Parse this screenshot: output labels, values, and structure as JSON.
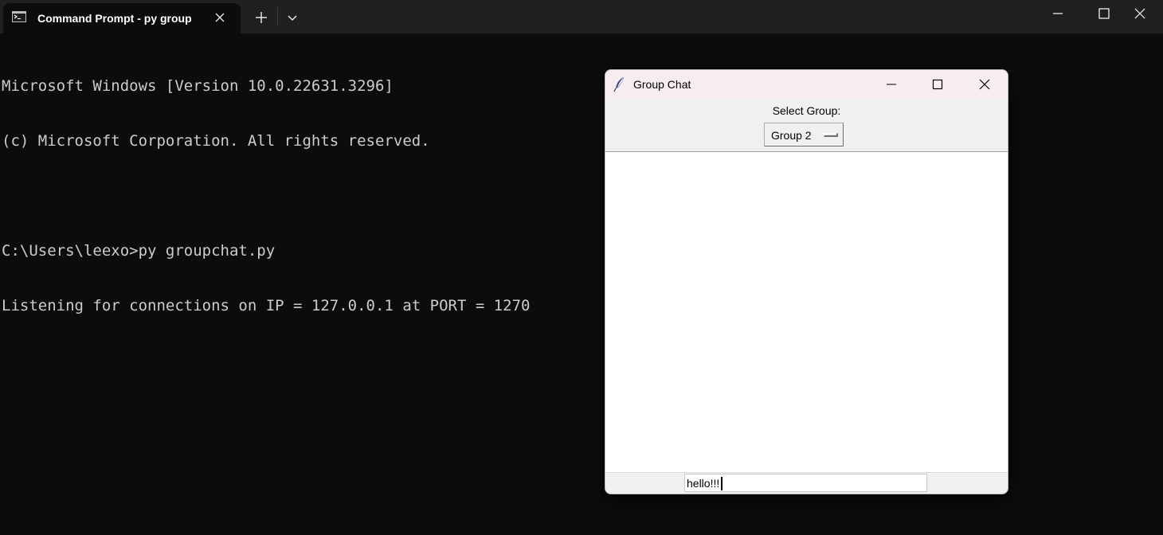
{
  "terminal": {
    "tab_title": "Command Prompt - py  group",
    "output_lines": [
      "Microsoft Windows [Version 10.0.22631.3296]",
      "(c) Microsoft Corporation. All rights reserved.",
      "",
      "C:\\Users\\leexo>py groupchat.py",
      "Listening for connections on IP = 127.0.0.1 at PORT = 1270"
    ],
    "icons": {
      "tab": "terminal-icon",
      "close_tab": "close-icon",
      "new_tab": "plus-icon",
      "dropdown": "chevron-down-icon",
      "minimize": "minimize-icon",
      "maximize": "maximize-icon",
      "close_window": "close-icon"
    },
    "colors": {
      "background": "#0c0c0c",
      "tabbar": "#202020",
      "text": "#cccccc"
    }
  },
  "chat_window": {
    "title": "Group Chat",
    "app_icon": "feather-icon",
    "select_label": "Select Group:",
    "selected_group": "Group 2",
    "input_value": "hello!!!",
    "colors": {
      "titlebar": "#f7ecef",
      "body": "#f0f0f0",
      "message_area": "#ffffff"
    }
  }
}
